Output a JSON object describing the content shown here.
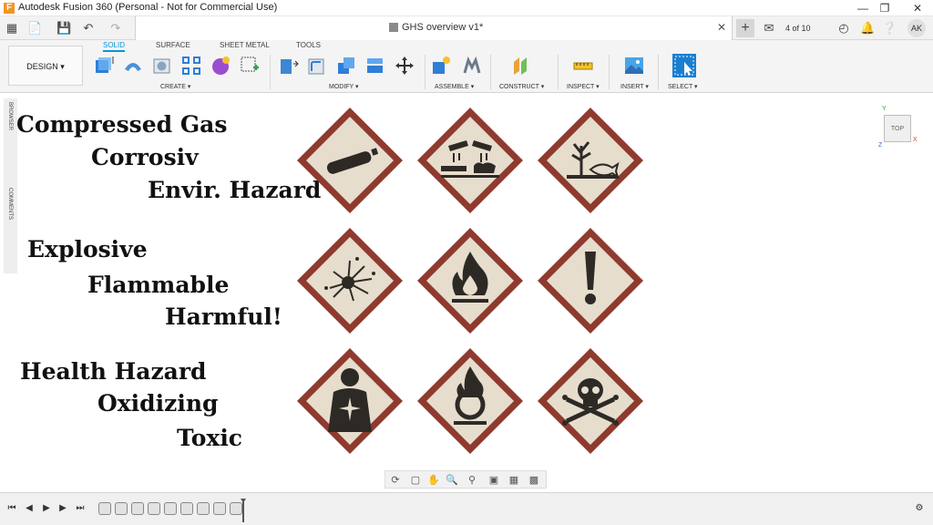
{
  "titlebar": {
    "title": "Autodesk Fusion 360 (Personal - Not for Commercial Use)"
  },
  "tabbar": {
    "doc_name": "GHS overview v1*",
    "job_status": "4 of 10",
    "user_initials": "AK"
  },
  "ribbon": {
    "workspace": "DESIGN",
    "tabs": [
      {
        "label": "SOLID"
      },
      {
        "label": "SURFACE"
      },
      {
        "label": "SHEET METAL"
      },
      {
        "label": "TOOLS"
      }
    ],
    "groups": [
      "CREATE",
      "MODIFY",
      "ASSEMBLE",
      "CONSTRUCT",
      "INSPECT",
      "INSERT",
      "SELECT"
    ]
  },
  "left_panel": {
    "browser": "BROWSER",
    "comments": "COMMENTS"
  },
  "viewcube": {
    "face": "TOP",
    "axes": [
      "Y",
      "Z",
      "X"
    ]
  },
  "canvas": {
    "labels": [
      "Compressed Gas",
      "Corrosiv",
      "Envir. Hazard",
      "Explosive",
      "Flammable",
      "Harmful!",
      "Health Hazard",
      "Oxidizing",
      "Toxic"
    ],
    "colors": {
      "diamond_border": "#8f3a2f",
      "diamond_fill": "#e6ddcd",
      "pictogram": "#2d2a26"
    },
    "symbols": [
      "gas-cylinder-icon",
      "corrosion-icon",
      "dead-tree-fish-icon",
      "exploding-bomb-icon",
      "flame-icon",
      "exclamation-mark-icon",
      "health-hazard-icon",
      "flame-over-circle-icon",
      "skull-crossbones-icon"
    ]
  },
  "timeline": {
    "feature_count": 9
  }
}
